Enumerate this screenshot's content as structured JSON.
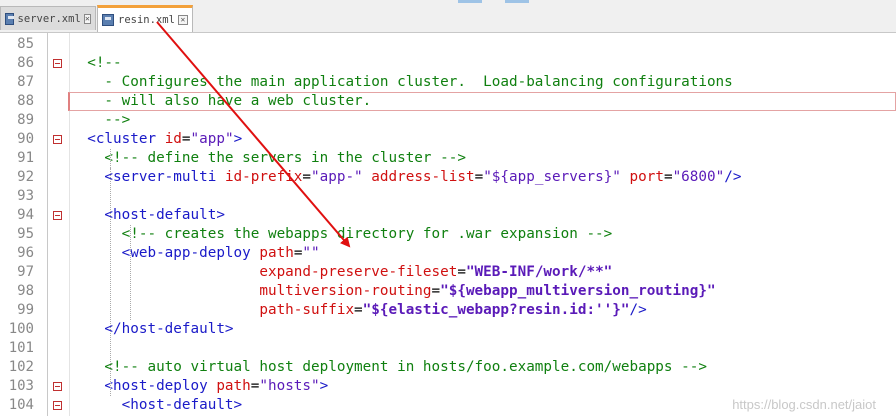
{
  "tabs": [
    {
      "label": "server.xml",
      "active": false
    },
    {
      "label": "resin.xml",
      "active": true
    }
  ],
  "lines": [
    {
      "num": "85",
      "fold": false,
      "segs": []
    },
    {
      "num": "86",
      "fold": true,
      "segs": [
        {
          "t": "  <!--",
          "c": "c-cm"
        }
      ]
    },
    {
      "num": "87",
      "fold": false,
      "segs": [
        {
          "t": "    - Configures the main application cluster.  Load-balancing configurations",
          "c": "c-cm"
        }
      ]
    },
    {
      "num": "88",
      "fold": false,
      "segs": [
        {
          "t": "    - will also have a web cluster.",
          "c": "c-cm"
        }
      ]
    },
    {
      "num": "89",
      "fold": false,
      "segs": [
        {
          "t": "    -->",
          "c": "c-cm"
        }
      ]
    },
    {
      "num": "90",
      "fold": true,
      "segs": [
        {
          "t": "  <cluster ",
          "c": "c-tag"
        },
        {
          "t": "id",
          "c": "c-attr"
        },
        {
          "t": "=",
          "c": ""
        },
        {
          "t": "\"app\"",
          "c": "c-val"
        },
        {
          "t": ">",
          "c": "c-tag"
        }
      ]
    },
    {
      "num": "91",
      "fold": false,
      "segs": [
        {
          "t": "    <!-- define the servers in the cluster -->",
          "c": "c-cm"
        }
      ]
    },
    {
      "num": "92",
      "fold": false,
      "segs": [
        {
          "t": "    <server-multi ",
          "c": "c-tag"
        },
        {
          "t": "id-prefix",
          "c": "c-attr"
        },
        {
          "t": "=",
          "c": ""
        },
        {
          "t": "\"app-\"",
          "c": "c-val"
        },
        {
          "t": " address-list",
          "c": "c-attr"
        },
        {
          "t": "=",
          "c": ""
        },
        {
          "t": "\"${app_servers}\"",
          "c": "c-val"
        },
        {
          "t": " port",
          "c": "c-attr"
        },
        {
          "t": "=",
          "c": ""
        },
        {
          "t": "\"6800\"",
          "c": "c-val"
        },
        {
          "t": "/>",
          "c": "c-tag"
        }
      ]
    },
    {
      "num": "93",
      "fold": false,
      "segs": []
    },
    {
      "num": "94",
      "fold": true,
      "segs": [
        {
          "t": "    <host-default>",
          "c": "c-tag"
        }
      ]
    },
    {
      "num": "95",
      "fold": false,
      "segs": [
        {
          "t": "      <!-- creates the webapps directory for .war expansion -->",
          "c": "c-cm"
        }
      ]
    },
    {
      "num": "96",
      "fold": false,
      "segs": [
        {
          "t": "      <web-app-deploy ",
          "c": "c-tag"
        },
        {
          "t": "path",
          "c": "c-attr"
        },
        {
          "t": "=",
          "c": ""
        },
        {
          "t": "\"\"",
          "c": "c-val"
        }
      ]
    },
    {
      "num": "97",
      "fold": false,
      "segs": [
        {
          "t": "                      expand-preserve-fileset",
          "c": "c-attr"
        },
        {
          "t": "=",
          "c": ""
        },
        {
          "t": "\"WEB-INF/work/**\"",
          "c": "c-val c-bold"
        }
      ]
    },
    {
      "num": "98",
      "fold": false,
      "segs": [
        {
          "t": "                      multiversion-routing",
          "c": "c-attr"
        },
        {
          "t": "=",
          "c": ""
        },
        {
          "t": "\"${webapp_multiversion_routing}\"",
          "c": "c-val c-bold"
        }
      ]
    },
    {
      "num": "99",
      "fold": false,
      "segs": [
        {
          "t": "                      path-suffix",
          "c": "c-attr"
        },
        {
          "t": "=",
          "c": ""
        },
        {
          "t": "\"${elastic_webapp?resin.id:''}\"",
          "c": "c-val c-bold"
        },
        {
          "t": "/>",
          "c": "c-tag"
        }
      ]
    },
    {
      "num": "100",
      "fold": false,
      "segs": [
        {
          "t": "    </host-default>",
          "c": "c-tag"
        }
      ]
    },
    {
      "num": "101",
      "fold": false,
      "segs": []
    },
    {
      "num": "102",
      "fold": false,
      "segs": [
        {
          "t": "    <!-- auto virtual host deployment in hosts/foo.example.com/webapps -->",
          "c": "c-cm"
        }
      ]
    },
    {
      "num": "103",
      "fold": true,
      "segs": [
        {
          "t": "    <host-deploy ",
          "c": "c-tag"
        },
        {
          "t": "path",
          "c": "c-attr"
        },
        {
          "t": "=",
          "c": ""
        },
        {
          "t": "\"hosts\"",
          "c": "c-val"
        },
        {
          "t": ">",
          "c": "c-tag"
        }
      ]
    },
    {
      "num": "104",
      "fold": true,
      "segs": [
        {
          "t": "      <host-default>",
          "c": "c-tag"
        }
      ]
    }
  ],
  "watermark": "https://blog.csdn.net/jaiot",
  "colors": {
    "arrow": "#e01010",
    "active_tab_accent": "#f3a13b"
  }
}
